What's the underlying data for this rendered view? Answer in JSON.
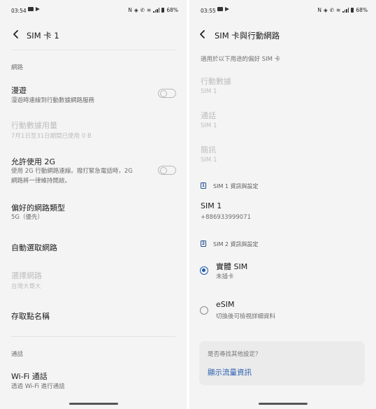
{
  "left": {
    "status": {
      "time": "03:54",
      "battery": "68%"
    },
    "title": "SIM 卡 1",
    "section_network": "網路",
    "roaming": {
      "title": "漫遊",
      "sub": "漫遊時連線到行動數據網路服務"
    },
    "data_usage": {
      "title": "行動數據用量",
      "sub": "7月1日至31日期間已使用 0 B"
    },
    "allow_2g": {
      "title": "允許使用 2G",
      "sub1": "使用 2G 行動網路連線。撥打緊急電話時，2G",
      "sub2": "網路將一律維持開啟。"
    },
    "preferred_network": {
      "title": "偏好的網路類型",
      "sub": "5G（優先）"
    },
    "auto_select": "自動選取網路",
    "choose_network": {
      "title": "選擇網路",
      "sub": "台灣大哥大"
    },
    "apn": "存取點名稱",
    "section_calls": "通話",
    "wifi_calling": {
      "title": "Wi-Fi 通話",
      "sub": "透過 Wi-Fi 進行通話"
    }
  },
  "right": {
    "status": {
      "time": "03:55",
      "battery": "68%"
    },
    "title": "SIM 卡與行動網路",
    "pref_header": "適用於以下用途的偏好 SIM 卡",
    "mobile_data": {
      "title": "行動數據",
      "sub": "SIM 1"
    },
    "calls": {
      "title": "通話",
      "sub": "SIM 1"
    },
    "sms": {
      "title": "簡訊",
      "sub": "SIM 1"
    },
    "sim1_header": {
      "num": "1",
      "label": "SIM 1 資訊與設定"
    },
    "sim1": {
      "name": "SIM 1",
      "number": "+886933999071"
    },
    "sim2_header": {
      "num": "2",
      "label": "SIM 2 資訊與設定"
    },
    "physical_sim": {
      "title": "實體 SIM",
      "sub": "未插卡"
    },
    "esim": {
      "title": "eSIM",
      "sub": "切換後可檢視詳細資料"
    },
    "card": {
      "question": "是否尋找其他設定？",
      "link": "顯示流量資訊"
    }
  },
  "colors": {
    "accent": "#1f5bb3",
    "link": "#2a5fb0",
    "background": "#f4f4f4"
  },
  "icons": [
    "back-arrow-icon",
    "toggle-switch-icon",
    "sim-card-icon",
    "radio-button-icon",
    "wifi-icon",
    "signal-icon",
    "battery-icon"
  ]
}
